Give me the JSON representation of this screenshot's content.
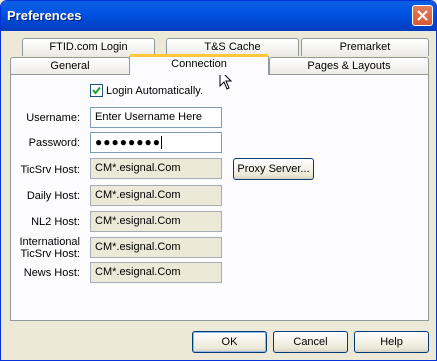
{
  "window": {
    "title": "Preferences"
  },
  "tabs_row1": [
    "FTID.com Login",
    "T&S Cache",
    "Premarket"
  ],
  "tabs_row2": [
    "General",
    "Connection",
    "Pages & Layouts"
  ],
  "active_tab": "Connection",
  "login_auto": {
    "label": "Login Automatically.",
    "checked": true
  },
  "fields": {
    "username": {
      "label": "Username:",
      "value": "Enter Username Here"
    },
    "password": {
      "label": "Password:",
      "value": "●●●●●●●●"
    },
    "ticsrv_host": {
      "label": "TicSrv Host:",
      "value": "CM*.esignal.Com"
    },
    "daily_host": {
      "label": "Daily Host:",
      "value": "CM*.esignal.Com"
    },
    "nl2_host": {
      "label": "NL2 Host:",
      "value": "CM*.esignal.Com"
    },
    "intl_ticsrv_host": {
      "label_line1": "International",
      "label_line2": "TicSrv Host:",
      "value": "CM*.esignal.Com"
    },
    "news_host": {
      "label": "News Host:",
      "value": "CM*.esignal.Com"
    }
  },
  "buttons": {
    "proxy": "Proxy Server...",
    "ok": "OK",
    "cancel": "Cancel",
    "help": "Help"
  },
  "colors": {
    "title_bar": "#0054e3",
    "close": "#d65a34",
    "active_tab_highlight": "#ffc83c"
  }
}
